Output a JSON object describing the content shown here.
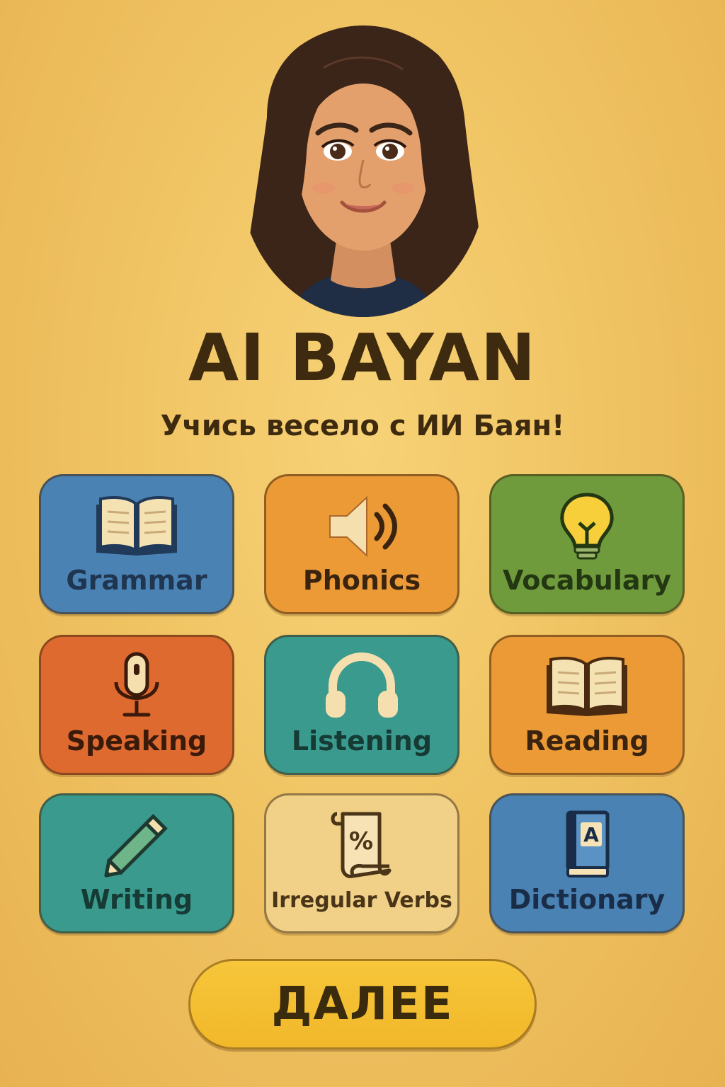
{
  "app": {
    "title": "AI BAYAN",
    "subtitle": "Учись весело с ИИ Баян!"
  },
  "theme": {
    "background": "#f0c463",
    "text": "#3e2a0e"
  },
  "tiles": [
    {
      "label": "Grammar",
      "icon": "open-book-icon",
      "color": "#4a82b3",
      "label_color": "#1f3550"
    },
    {
      "label": "Phonics",
      "icon": "speaker-icon",
      "color": "#ec9a36",
      "label_color": "#3a2410"
    },
    {
      "label": "Vocabulary",
      "icon": "lightbulb-icon",
      "color": "#6f9b3c",
      "label_color": "#233812"
    },
    {
      "label": "Speaking",
      "icon": "microphone-icon",
      "color": "#df6a30",
      "label_color": "#3a1a0a"
    },
    {
      "label": "Listening",
      "icon": "headphones-icon",
      "color": "#3a9a8e",
      "label_color": "#163a34"
    },
    {
      "label": "Reading",
      "icon": "open-book-icon",
      "color": "#ec9a36",
      "label_color": "#3a2410"
    },
    {
      "label": "Writing",
      "icon": "pencil-icon",
      "color": "#3a9a8e",
      "label_color": "#163a34"
    },
    {
      "label": "Irregular Verbs",
      "icon": "scroll-percent-icon",
      "color": "#f1d188",
      "label_color": "#4a3518"
    },
    {
      "label": "Dictionary",
      "icon": "dictionary-book-icon",
      "color": "#4a82b3",
      "label_color": "#1a2d48"
    }
  ],
  "next_button": {
    "label": "ДАЛЕЕ"
  },
  "icon_glyphs": {
    "scroll_symbol": "%",
    "dictionary_letter": "A"
  }
}
